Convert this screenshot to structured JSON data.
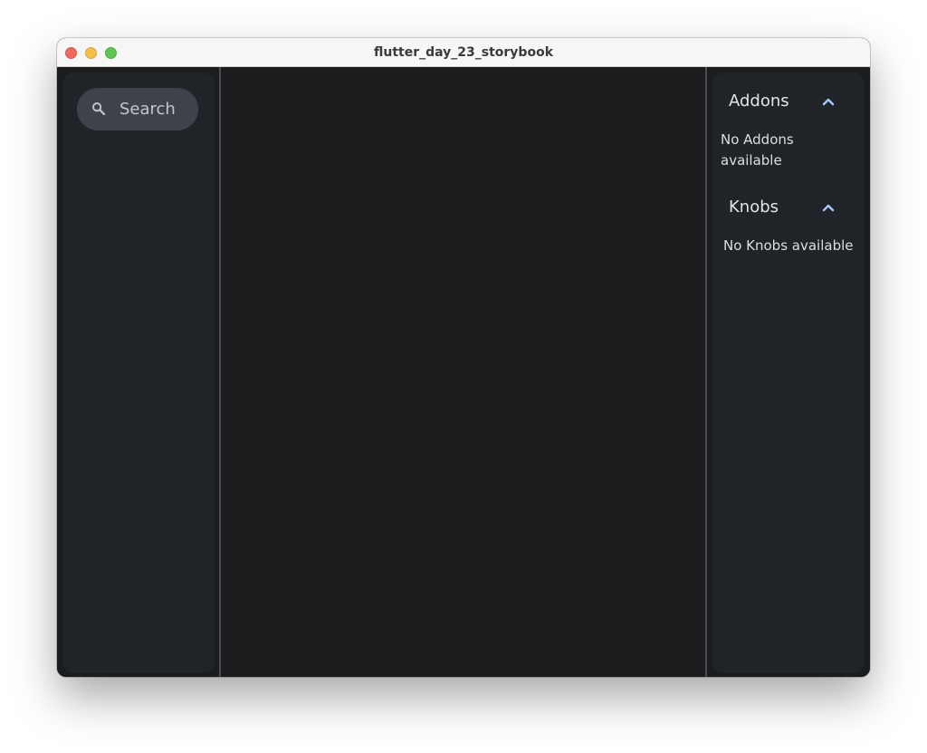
{
  "window": {
    "title": "flutter_day_23_storybook"
  },
  "sidebar": {
    "search": {
      "icon": "search-icon",
      "label": "Search"
    }
  },
  "addons_panel": {
    "addons": {
      "title": "Addons",
      "icon": "chevron-up-icon",
      "empty_text": "No Addons available"
    },
    "knobs": {
      "title": "Knobs",
      "icon": "chevron-up-icon",
      "empty_text": "No Knobs available"
    }
  },
  "colors": {
    "background": "#1b1c1e",
    "panel": "#202327",
    "search_field": "#3f4349",
    "accent": "#a8c7fa"
  }
}
